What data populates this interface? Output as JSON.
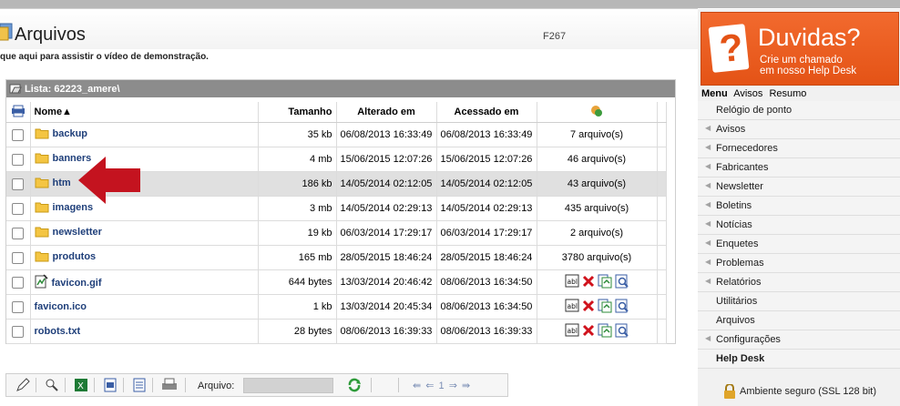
{
  "header": {
    "title": "Arquivos",
    "code": "F267",
    "help_text": "que aqui para assistir o vídeo de demonstração."
  },
  "list": {
    "title": "Lista: 62223_amere\\",
    "columns": [
      "Nome▲",
      "Tamanho",
      "Alterado em",
      "Acessado em"
    ],
    "rows": [
      {
        "name": "backup",
        "type": "folder",
        "size": "35 kb",
        "modified": "06/08/2013 16:33:49",
        "accessed": "06/08/2013 16:33:49",
        "files": "7 arquivo(s)"
      },
      {
        "name": "banners",
        "type": "folder",
        "size": "4 mb",
        "modified": "15/06/2015 12:07:26",
        "accessed": "15/06/2015 12:07:26",
        "files": "46 arquivo(s)"
      },
      {
        "name": "htm",
        "type": "folder",
        "size": "186 kb",
        "modified": "14/05/2014 02:12:05",
        "accessed": "14/05/2014 02:12:05",
        "files": "43 arquivo(s)"
      },
      {
        "name": "imagens",
        "type": "folder",
        "size": "3 mb",
        "modified": "14/05/2014 02:29:13",
        "accessed": "14/05/2014 02:29:13",
        "files": "435 arquivo(s)"
      },
      {
        "name": "newsletter",
        "type": "folder",
        "size": "19 kb",
        "modified": "06/03/2014 17:29:17",
        "accessed": "06/03/2014 17:29:17",
        "files": "2 arquivo(s)"
      },
      {
        "name": "produtos",
        "type": "folder",
        "size": "165 mb",
        "modified": "28/05/2015 18:46:24",
        "accessed": "28/05/2015 18:46:24",
        "files": "3780 arquivo(s)"
      },
      {
        "name": "favicon.gif",
        "type": "image",
        "size": "644 bytes",
        "modified": "13/03/2014 20:46:42",
        "accessed": "08/06/2013 16:34:50",
        "files": ""
      },
      {
        "name": "favicon.ico",
        "type": "file",
        "size": "1 kb",
        "modified": "13/03/2014 20:45:34",
        "accessed": "08/06/2013 16:34:50",
        "files": ""
      },
      {
        "name": "robots.txt",
        "type": "file",
        "size": "28 bytes",
        "modified": "08/06/2013 16:39:33",
        "accessed": "08/06/2013 16:39:33",
        "files": ""
      }
    ]
  },
  "toolbar": {
    "file_label": "Arquivo:",
    "pager": "⇚ ⇐ 1 ⇒ ⇛"
  },
  "sidebar": {
    "banner_title": "Duvidas?",
    "banner_sub1": "Crie um chamado",
    "banner_sub2": "em nosso Help Desk",
    "tab_menu": "Menu",
    "tab_avisos": "Avisos",
    "tab_resumo": "Resumo",
    "items": [
      {
        "label": "Relógio de ponto",
        "arrow": false,
        "bold": false
      },
      {
        "label": "Avisos",
        "arrow": true,
        "bold": false
      },
      {
        "label": "Fornecedores",
        "arrow": true,
        "bold": false
      },
      {
        "label": "Fabricantes",
        "arrow": true,
        "bold": false
      },
      {
        "label": "Newsletter",
        "arrow": true,
        "bold": false
      },
      {
        "label": "Boletins",
        "arrow": true,
        "bold": false
      },
      {
        "label": "Notícias",
        "arrow": true,
        "bold": false
      },
      {
        "label": "Enquetes",
        "arrow": true,
        "bold": false
      },
      {
        "label": "Problemas",
        "arrow": true,
        "bold": false
      },
      {
        "label": "Relatórios",
        "arrow": true,
        "bold": false
      },
      {
        "label": "Utilitários",
        "arrow": false,
        "bold": false
      },
      {
        "label": "Arquivos",
        "arrow": false,
        "bold": false
      },
      {
        "label": "Configurações",
        "arrow": true,
        "bold": false
      },
      {
        "label": "Help Desk",
        "arrow": false,
        "bold": true
      }
    ],
    "secure_text": "Ambiente seguro (SSL 128 bit)"
  },
  "colors": {
    "accent_orange": "#e45316",
    "link_blue": "#1f3f7a",
    "arrow_red": "#c4131f",
    "title_bar": "#8c8c8c"
  },
  "highlighted_row": 2
}
